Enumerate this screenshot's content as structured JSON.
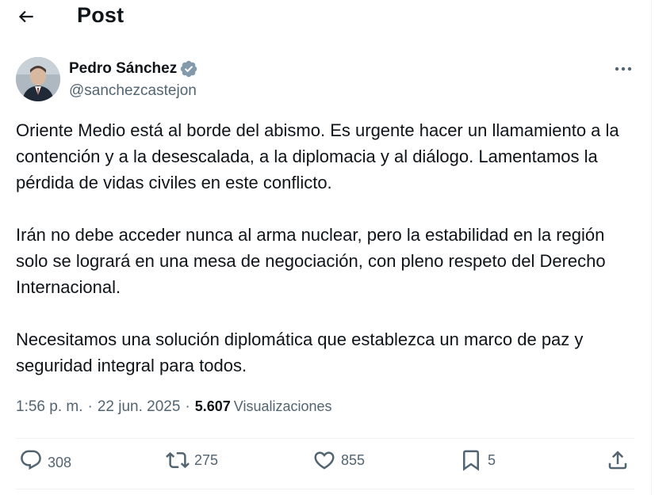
{
  "header": {
    "title": "Post",
    "back_icon": "arrow-left-icon"
  },
  "author": {
    "name": "Pedro Sánchez",
    "handle": "@sanchezcastejon",
    "verified_color": "#829aab"
  },
  "tweet": {
    "paragraphs": [
      "Oriente Medio está al borde del abismo. Es urgente hacer un llamamiento a la contención y a la desescalada, a la diplomacia y al diálogo. Lamentamos la pérdida de vidas civiles en este conflicto.",
      "Irán no debe acceder nunca al arma nuclear, pero la estabilidad en la región solo se logrará en una mesa de negociación, con pleno respeto del Derecho Internacional.",
      "Necesitamos una solución diplomática que establezca un marco de paz y seguridad integral para todos."
    ],
    "time": "1:56 p. m.",
    "separator": "·",
    "date": "22 jun. 2025",
    "views_count": "5.607",
    "views_label": "Visualizaciones"
  },
  "actions": {
    "replies": "308",
    "reposts": "275",
    "likes": "855",
    "bookmarks": "5"
  },
  "colors": {
    "text": "#0f1419",
    "secondary": "#536471",
    "border": "#eff3f4"
  }
}
